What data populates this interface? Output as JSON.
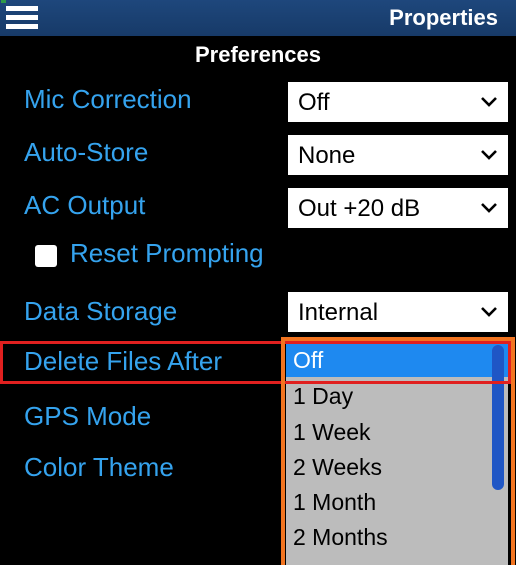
{
  "header": {
    "title": "Properties",
    "menu_icon": "hamburger-menu-icon"
  },
  "section_title": "Preferences",
  "settings": {
    "mic_correction": {
      "label": "Mic Correction",
      "value": "Off"
    },
    "auto_store": {
      "label": "Auto-Store",
      "value": "None"
    },
    "ac_output": {
      "label": "AC Output",
      "value": "Out +20 dB"
    },
    "reset_prompting": {
      "label": "Reset Prompting",
      "checked": false
    },
    "data_storage": {
      "label": "Data Storage",
      "value": "Internal"
    },
    "delete_files_after": {
      "label": "Delete Files After"
    },
    "gps_mode": {
      "label": "GPS Mode"
    },
    "color_theme": {
      "label": "Color Theme"
    }
  },
  "dropdown": {
    "selected": "Off",
    "options": [
      "Off",
      "1 Day",
      "1 Week",
      "2 Weeks",
      "1 Month",
      "2 Months"
    ]
  },
  "colors": {
    "header_bg": "#1e477c",
    "label_blue": "#35a3ee",
    "selected_option": "#1e89f0",
    "dropdown_bg": "#bcbcbc",
    "row_highlight": "#e0201f",
    "dropdown_highlight": "#f27420"
  }
}
